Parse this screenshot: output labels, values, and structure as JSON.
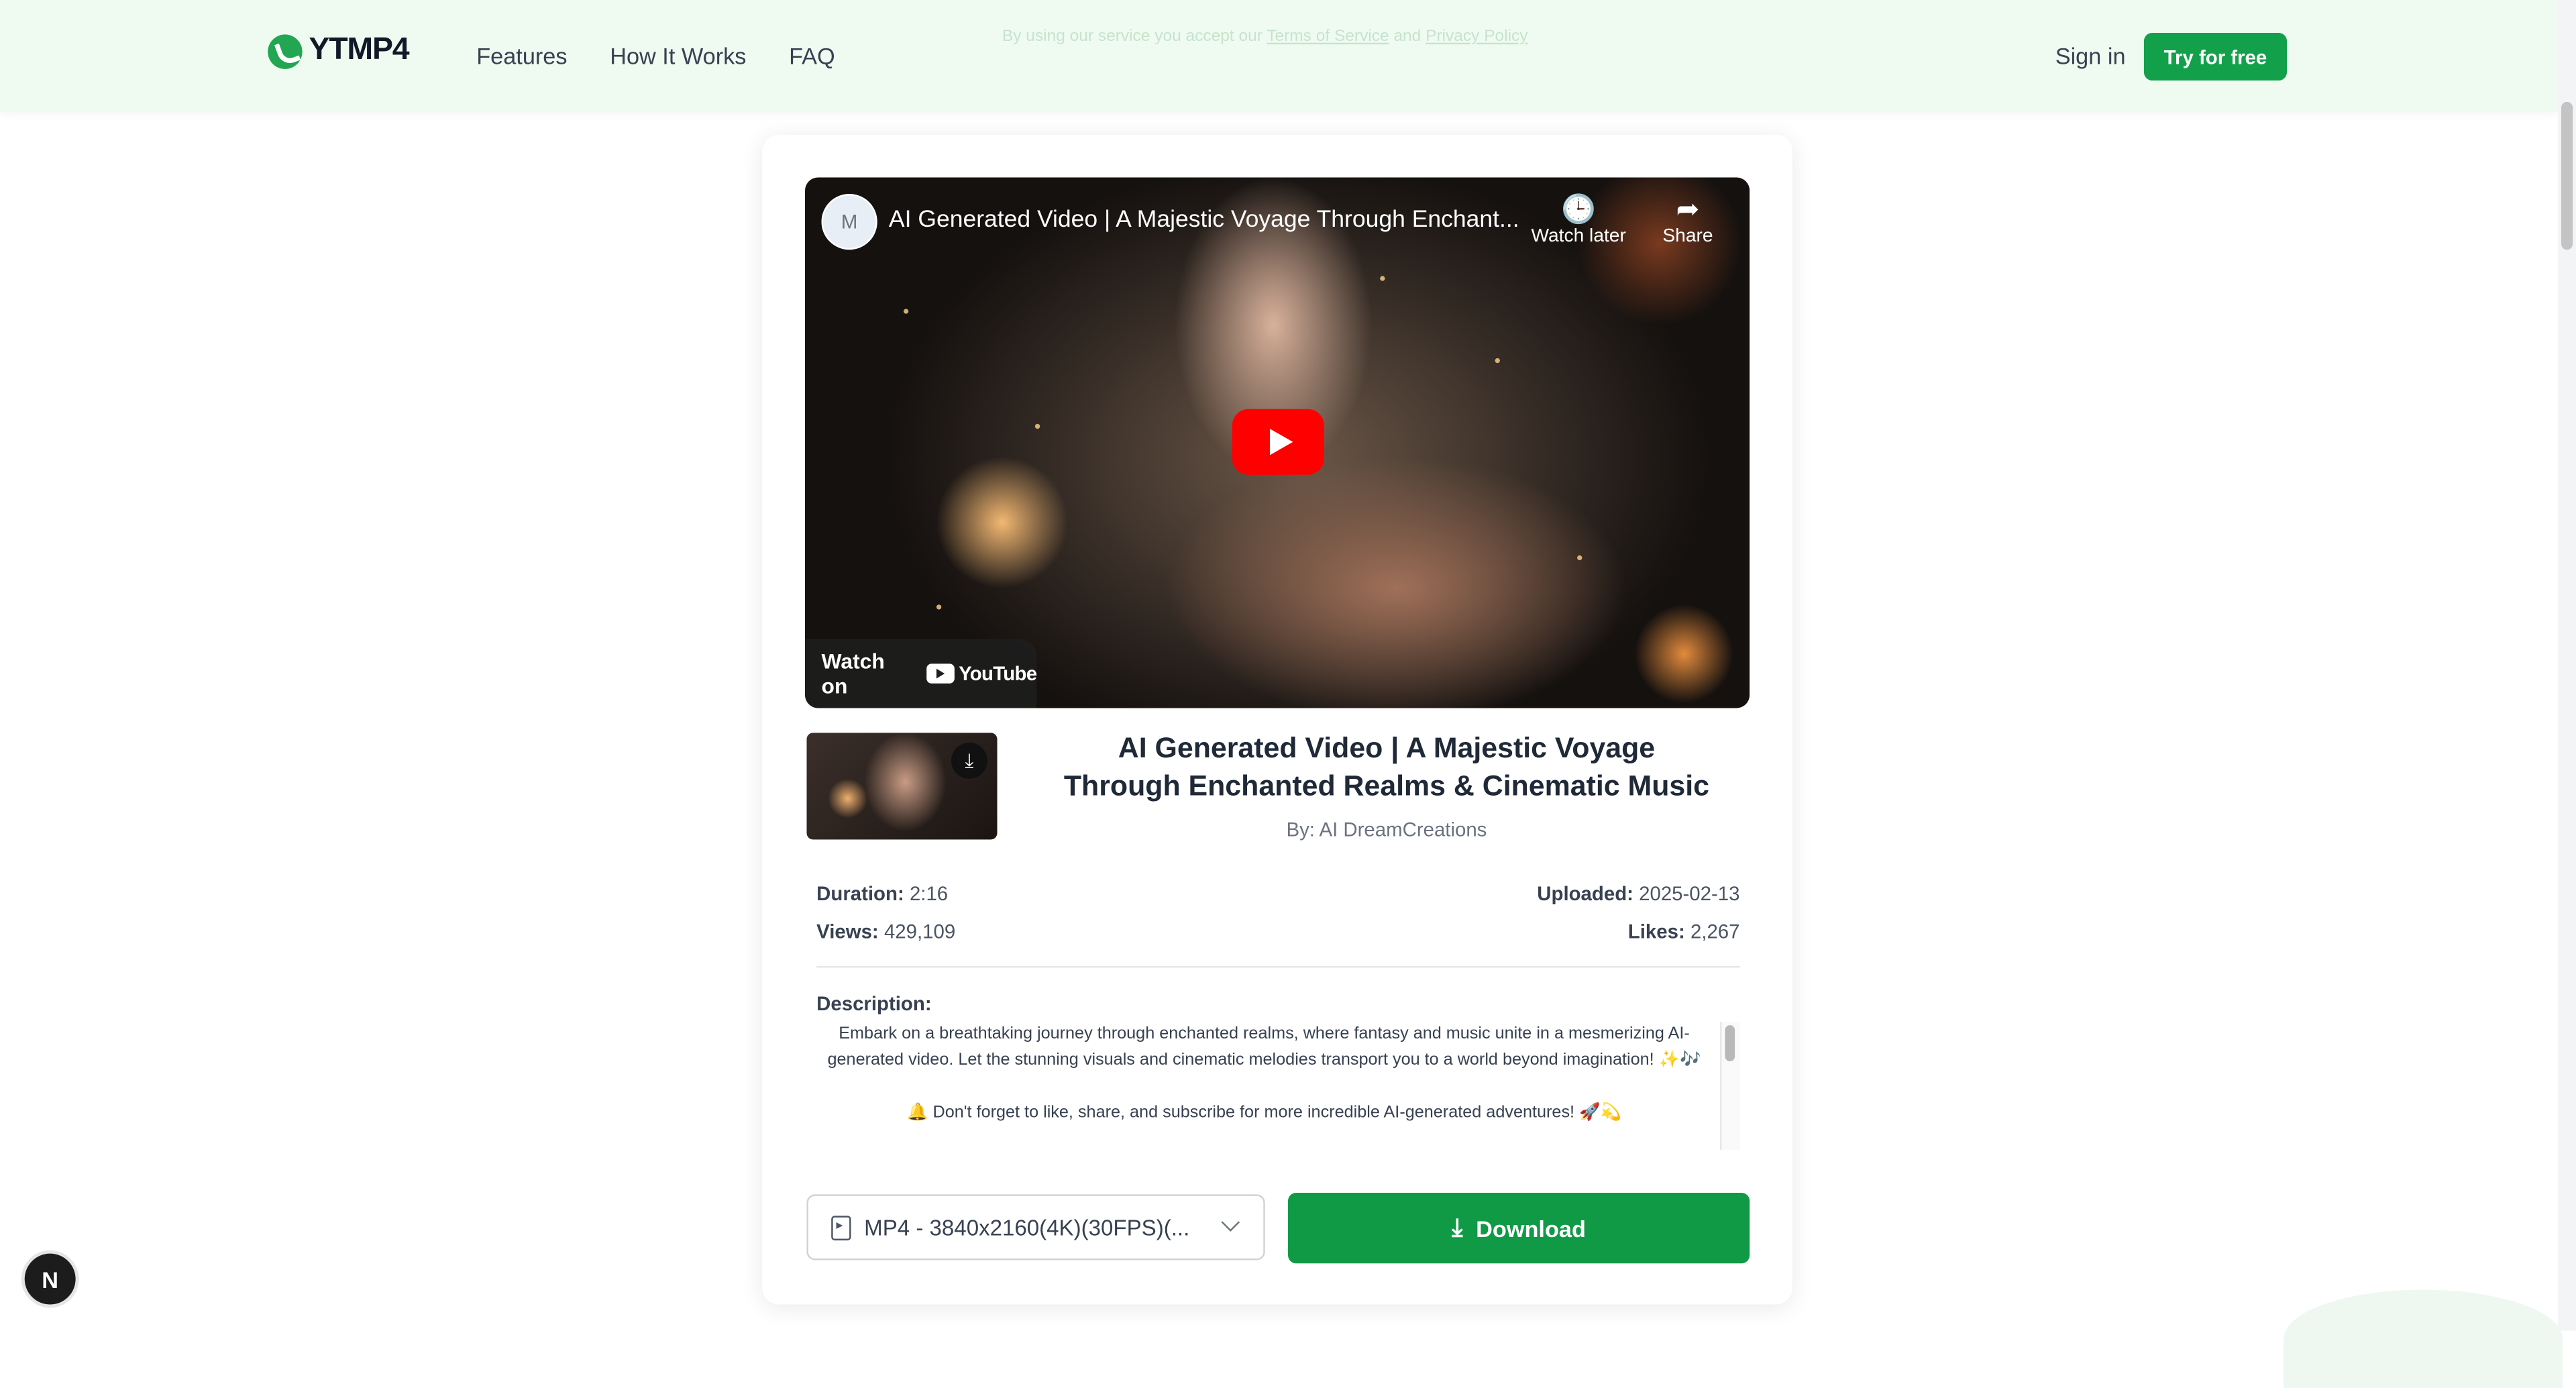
{
  "header": {
    "brand": "YTMP4",
    "notice_prefix": "By using our service you accept our",
    "notice_terms": "Terms of Service",
    "notice_and": "and",
    "notice_privacy": "Privacy Policy",
    "nav": [
      "Features",
      "How It Works",
      "FAQ"
    ],
    "sign_in": "Sign in",
    "cta": "Try for free"
  },
  "player": {
    "title": "AI Generated Video | A Majestic Voyage Through Enchant...",
    "watch_later": "Watch later",
    "share": "Share",
    "watch_on": "Watch on",
    "youtube": "YouTube"
  },
  "video": {
    "title": "AI Generated Video | A Majestic Voyage Through Enchanted Realms & Cinematic Music",
    "author": "By: AI DreamCreations",
    "duration_label": "Duration:",
    "duration": "2:16",
    "views_label": "Views:",
    "views": "429,109",
    "uploaded_label": "Uploaded:",
    "uploaded": "2025-02-13",
    "likes_label": "Likes:",
    "likes": "2,267",
    "description_label": "Description:",
    "description_1": "Embark on a breathtaking journey through enchanted realms, where fantasy and music unite in a mesmerizing AI-generated video. Let the stunning visuals and cinematic melodies transport you to a world beyond imagination! ✨🎶",
    "description_2": "🔔 Don't forget to like, share, and subscribe for more incredible AI-generated adventures! 🚀💫"
  },
  "download": {
    "format": "MP4 - 3840x2160(4K)(30FPS)(...",
    "button": "Download"
  },
  "badge": "N",
  "colors": {
    "accent": "#109a46",
    "header_bg": "#effbf1",
    "youtube_red": "#ff0000"
  }
}
